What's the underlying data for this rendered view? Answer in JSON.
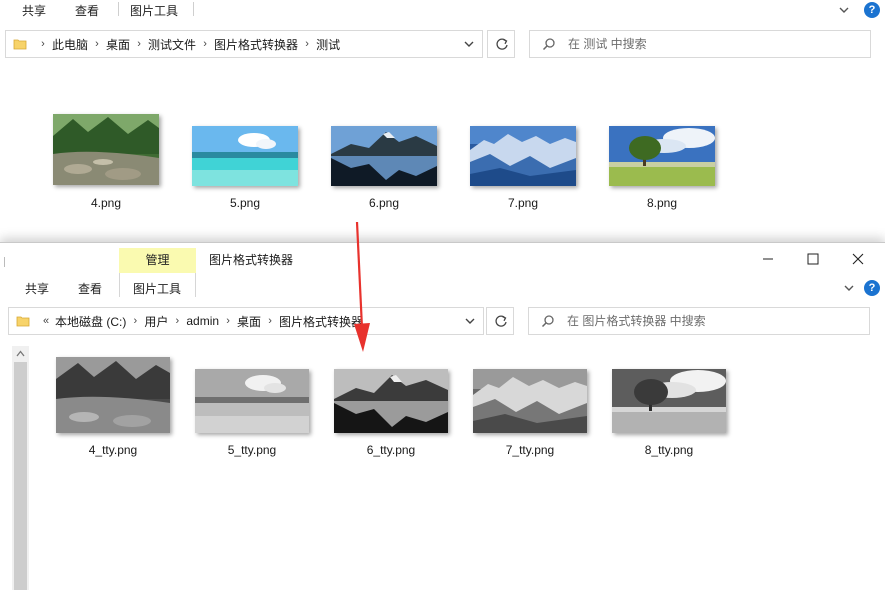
{
  "top_window": {
    "ribbon_tabs": [
      "共享",
      "查看",
      "图片工具"
    ],
    "breadcrumb": [
      "此电脑",
      "桌面",
      "测试文件",
      "图片格式转换器",
      "测试"
    ],
    "search_placeholder": "在 测试 中搜索",
    "files": [
      {
        "name": "4.png",
        "scene": "forest-stream"
      },
      {
        "name": "5.png",
        "scene": "tropical-beach"
      },
      {
        "name": "6.png",
        "scene": "mountain-lake"
      },
      {
        "name": "7.png",
        "scene": "blue-mountains"
      },
      {
        "name": "8.png",
        "scene": "lone-tree"
      }
    ]
  },
  "bottom_window": {
    "context_tab": "管理",
    "title": "图片格式转换器",
    "ribbon_tabs": [
      "共享",
      "查看",
      "图片工具"
    ],
    "breadcrumb_prefix": "«",
    "breadcrumb": [
      "本地磁盘 (C:)",
      "用户",
      "admin",
      "桌面",
      "图片格式转换器"
    ],
    "search_placeholder": "在 图片格式转换器 中搜索",
    "files": [
      {
        "name": "4_tty.png",
        "scene": "forest-stream-grayscale"
      },
      {
        "name": "5_tty.png",
        "scene": "tropical-beach-grayscale"
      },
      {
        "name": "6_tty.png",
        "scene": "mountain-lake-grayscale"
      },
      {
        "name": "7_tty.png",
        "scene": "blue-mountains-grayscale"
      },
      {
        "name": "8_tty.png",
        "scene": "lone-tree-grayscale"
      }
    ]
  },
  "icons": {
    "help": "help-icon",
    "refresh": "refresh-icon",
    "search": "search-icon",
    "folder": "folder-icon",
    "dropdown": "chevron-down-icon"
  },
  "colors": {
    "accent": "#1b73d0",
    "manage_tab_bg": "#fafab0",
    "annotation_arrow": "#e8322d"
  }
}
